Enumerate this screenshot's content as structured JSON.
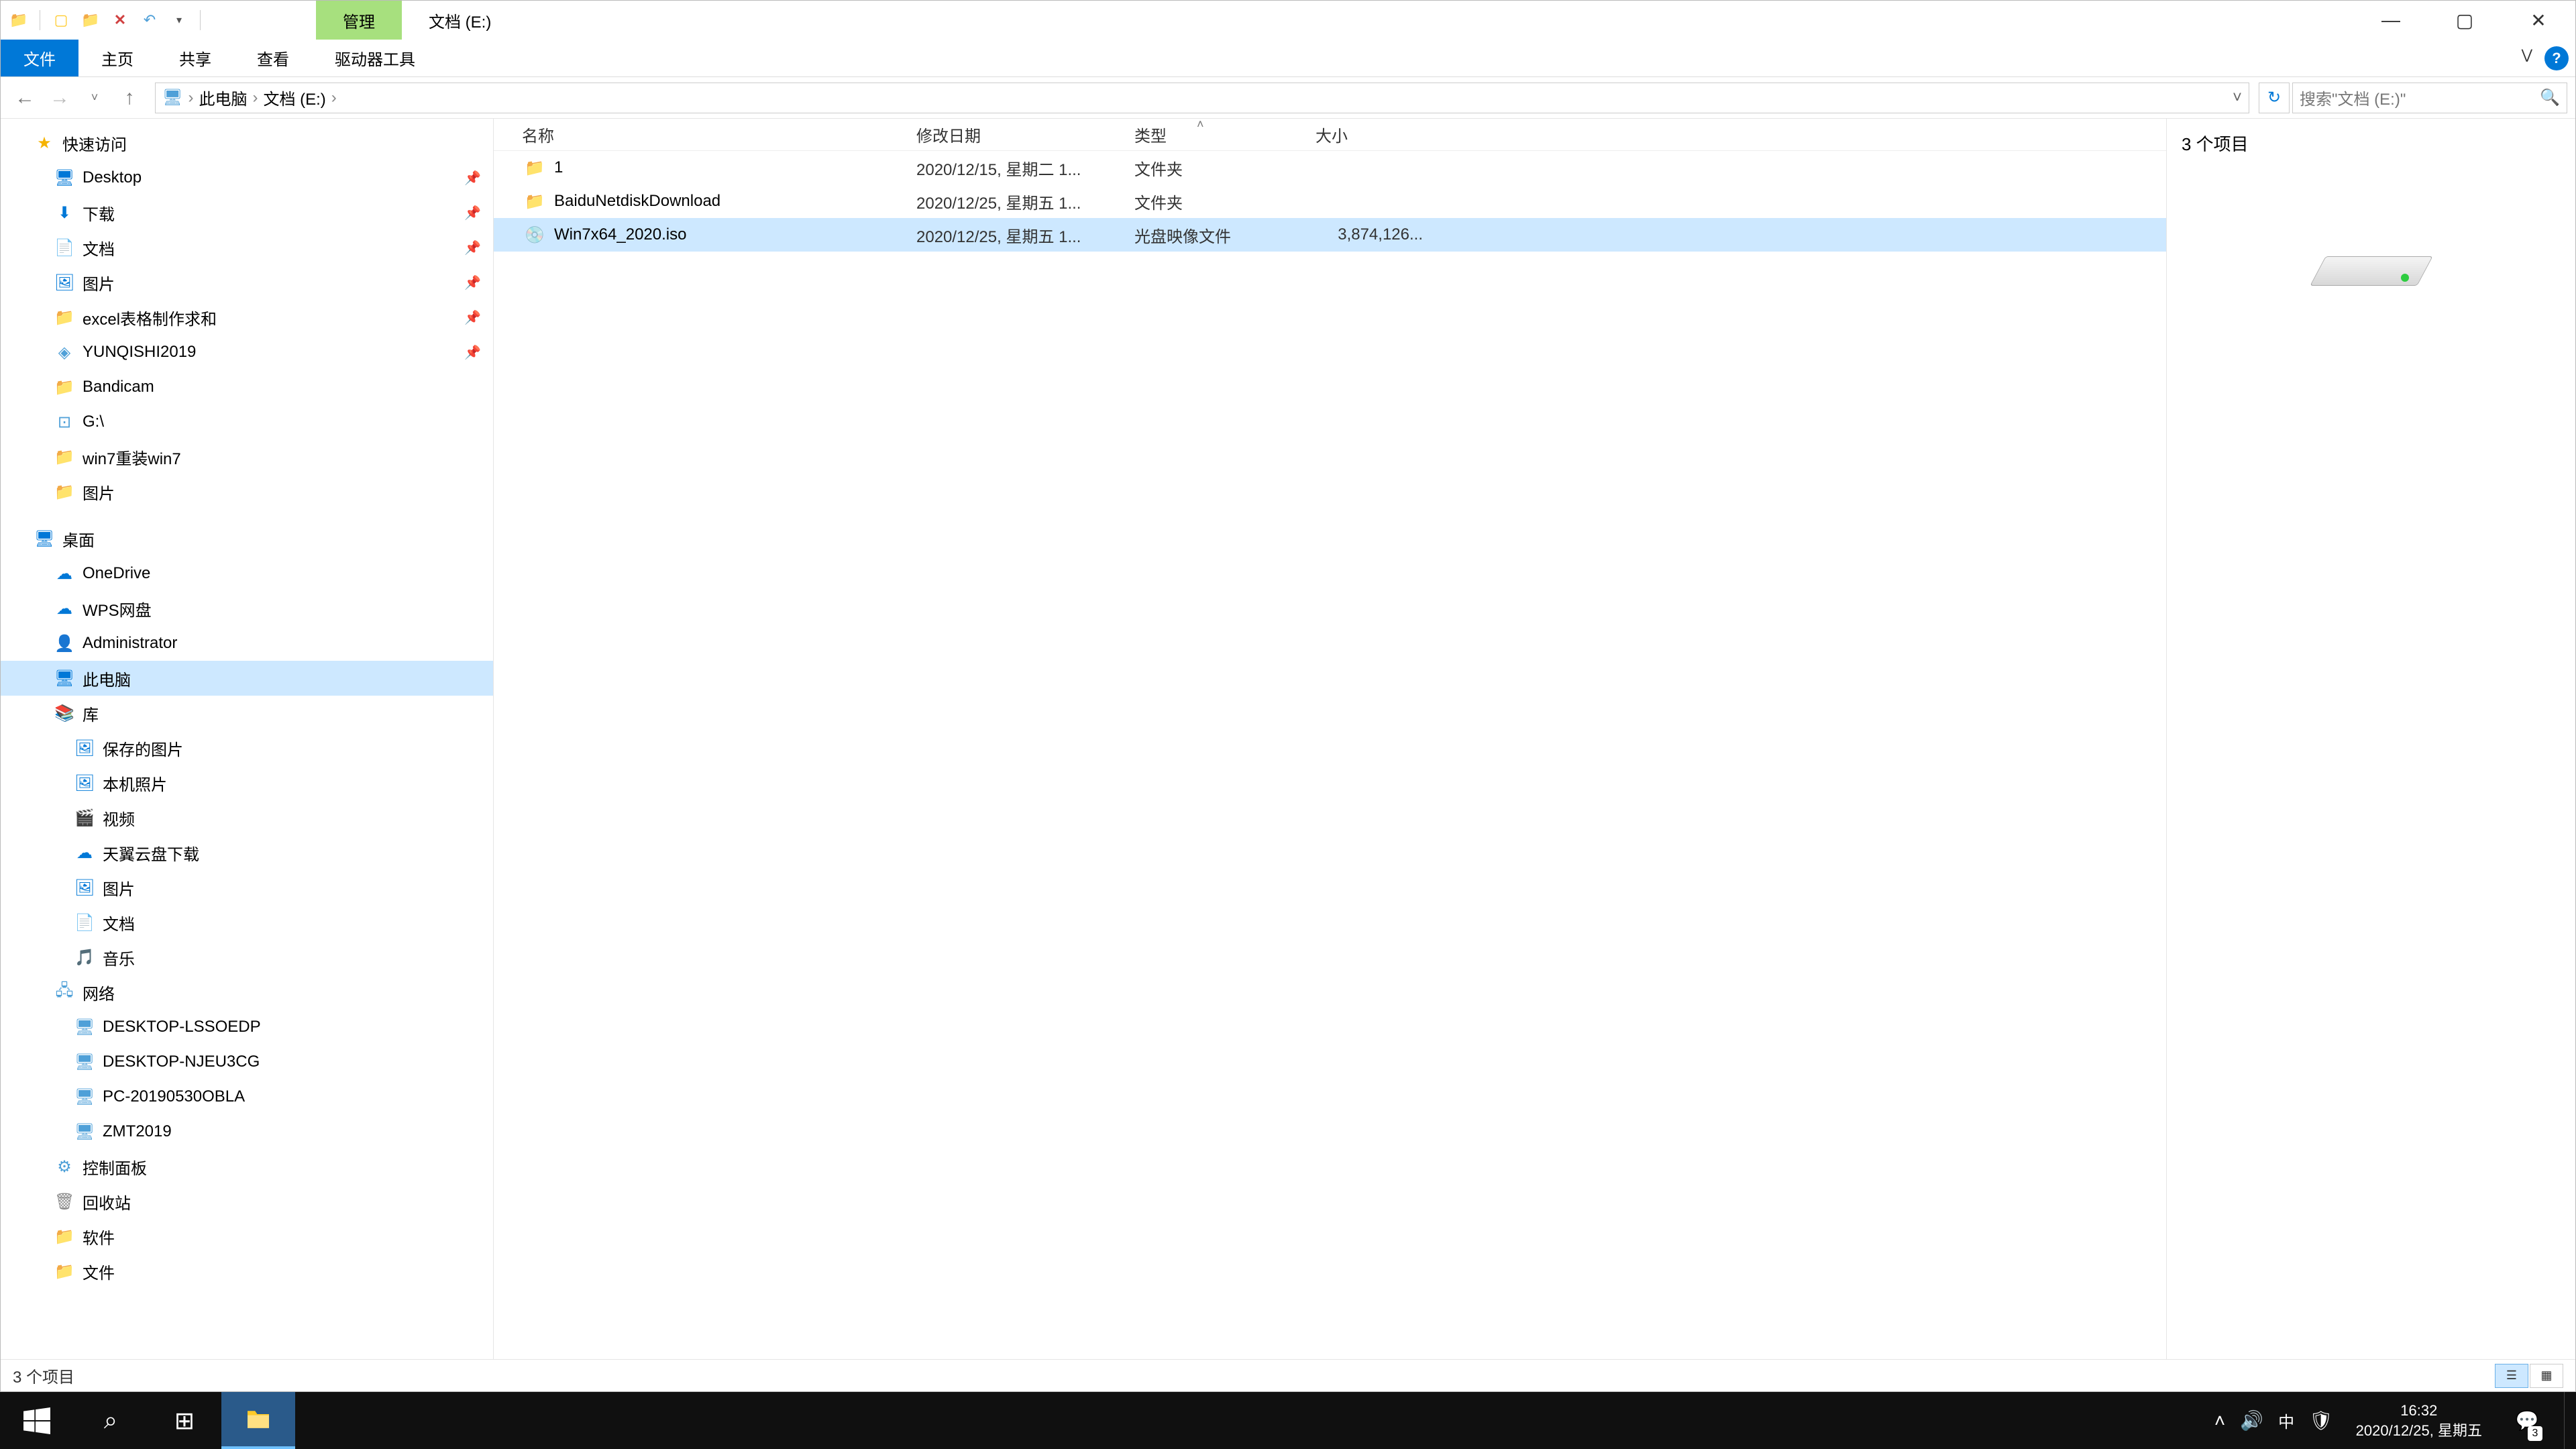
{
  "titlebar": {
    "context_tab": "管理",
    "title": "文档 (E:)"
  },
  "ribbon": {
    "file": "文件",
    "tabs": [
      "主页",
      "共享",
      "查看"
    ],
    "context": "驱动器工具"
  },
  "address": {
    "crumbs": [
      "此电脑",
      "文档 (E:)"
    ]
  },
  "search": {
    "placeholder": "搜索\"文档 (E:)\""
  },
  "tree": {
    "quick_access": "快速访问",
    "quick_items": [
      {
        "icon": "blue",
        "label": "Desktop",
        "pin": true
      },
      {
        "icon": "blue",
        "label": "下载",
        "pin": true
      },
      {
        "icon": "blue",
        "label": "文档",
        "pin": true
      },
      {
        "icon": "blue",
        "label": "图片",
        "pin": true
      },
      {
        "icon": "folder",
        "label": "excel表格制作求和",
        "pin": true
      },
      {
        "icon": "app",
        "label": "YUNQISHI2019",
        "pin": true
      },
      {
        "icon": "folder",
        "label": "Bandicam",
        "pin": false
      },
      {
        "icon": "drive",
        "label": "G:\\",
        "pin": false
      },
      {
        "icon": "folder",
        "label": "win7重装win7",
        "pin": false
      },
      {
        "icon": "folder",
        "label": "图片",
        "pin": false
      }
    ],
    "desktop": "桌面",
    "desktop_items": [
      {
        "icon": "cloud",
        "label": "OneDrive"
      },
      {
        "icon": "cloud",
        "label": "WPS网盘"
      },
      {
        "icon": "user",
        "label": "Administrator"
      },
      {
        "icon": "pc",
        "label": "此电脑",
        "selected": true
      },
      {
        "icon": "lib",
        "label": "库"
      }
    ],
    "lib_items": [
      {
        "icon": "blue",
        "label": "保存的图片"
      },
      {
        "icon": "blue",
        "label": "本机照片"
      },
      {
        "icon": "blue",
        "label": "视频"
      },
      {
        "icon": "blue",
        "label": "天翼云盘下载"
      },
      {
        "icon": "blue",
        "label": "图片"
      },
      {
        "icon": "blue",
        "label": "文档"
      },
      {
        "icon": "blue",
        "label": "音乐"
      }
    ],
    "network": "网络",
    "net_items": [
      {
        "label": "DESKTOP-LSSOEDP"
      },
      {
        "label": "DESKTOP-NJEU3CG"
      },
      {
        "label": "PC-20190530OBLA"
      },
      {
        "label": "ZMT2019"
      }
    ],
    "ctrl_panel": "控制面板",
    "recycle": "回收站",
    "software": "软件",
    "docs": "文件"
  },
  "columns": {
    "name": "名称",
    "date": "修改日期",
    "type": "类型",
    "size": "大小"
  },
  "rows": [
    {
      "icon": "folder",
      "name": "1",
      "date": "2020/12/15, 星期二 1...",
      "type": "文件夹",
      "size": ""
    },
    {
      "icon": "folder",
      "name": "BaiduNetdiskDownload",
      "date": "2020/12/25, 星期五 1...",
      "type": "文件夹",
      "size": ""
    },
    {
      "icon": "disc",
      "name": "Win7x64_2020.iso",
      "date": "2020/12/25, 星期五 1...",
      "type": "光盘映像文件",
      "size": "3,874,126...",
      "selected": true
    }
  ],
  "preview": {
    "summary": "3 个项目"
  },
  "status": {
    "text": "3 个项目"
  },
  "taskbar": {
    "time": "16:32",
    "date": "2020/12/25, 星期五",
    "ime": "中",
    "notif_count": "3"
  }
}
